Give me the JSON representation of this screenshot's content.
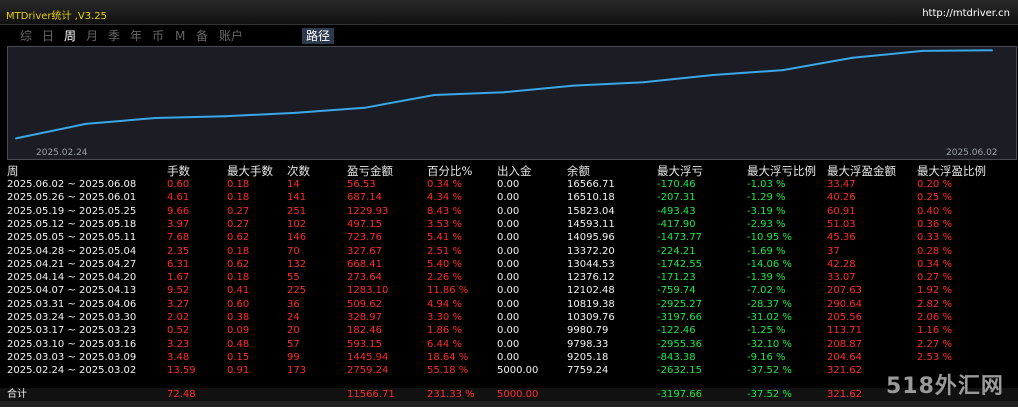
{
  "window": {
    "title": "MTDriver统计 ,V3.25",
    "link": "http://mtdriver.cn"
  },
  "tabs": [
    {
      "label": "综",
      "active": false
    },
    {
      "label": "日",
      "active": false
    },
    {
      "label": "周",
      "active": true
    },
    {
      "label": "月",
      "active": false
    },
    {
      "label": "季",
      "active": false
    },
    {
      "label": "年",
      "active": false
    },
    {
      "label": "币",
      "active": false
    },
    {
      "label": "M",
      "active": false
    },
    {
      "label": "备",
      "active": false
    },
    {
      "label": "账户",
      "active": false
    },
    {
      "label": "路径",
      "active": true
    }
  ],
  "chart_data": {
    "type": "line",
    "x_start_label": "2025.02.24",
    "x_end_label": "2025.06.02",
    "x": [
      "2025.02.24",
      "2025.03.03",
      "2025.03.10",
      "2025.03.17",
      "2025.03.24",
      "2025.03.31",
      "2025.04.07",
      "2025.04.14",
      "2025.04.21",
      "2025.04.28",
      "2025.05.05",
      "2025.05.12",
      "2025.05.19",
      "2025.05.26",
      "2025.06.02"
    ],
    "series": [
      {
        "values": [
          7759.24,
          9205.18,
          9798.33,
          9980.79,
          10309.76,
          10819.38,
          12102.48,
          12376.12,
          13044.53,
          13372.2,
          14095.96,
          14593.11,
          15823.04,
          16510.18,
          16566.71
        ]
      }
    ],
    "color": "#3aa8e8"
  },
  "headers": {
    "week": "周",
    "lots": "手数",
    "max_lots": "最大手数",
    "count": "次数",
    "pnl": "盈亏金额",
    "pct": "百分比%",
    "io": "出入金",
    "balance": "余额",
    "max_dd": "最大浮亏",
    "max_dd_pct": "最大浮亏比例",
    "max_fp": "最大浮盈金额",
    "max_fp_pct": "最大浮盈比例"
  },
  "rows": [
    {
      "week": "2025.06.02 ~ 2025.06.08",
      "lots": "0.60",
      "max_lots": "0.18",
      "count": "14",
      "pnl": "56.53",
      "pct": "0.34 %",
      "io": "0.00",
      "balance": "16566.71",
      "max_dd": "-170.46",
      "max_dd_pct": "-1.03 %",
      "max_fp": "33.47",
      "max_fp_pct": "0.20 %"
    },
    {
      "week": "2025.05.26 ~ 2025.06.01",
      "lots": "4.61",
      "max_lots": "0.18",
      "count": "141",
      "pnl": "687.14",
      "pct": "4.34 %",
      "io": "0.00",
      "balance": "16510.18",
      "max_dd": "-207.31",
      "max_dd_pct": "-1.29 %",
      "max_fp": "40.26",
      "max_fp_pct": "0.25 %"
    },
    {
      "week": "2025.05.19 ~ 2025.05.25",
      "lots": "9.66",
      "max_lots": "0.27",
      "count": "251",
      "pnl": "1229.93",
      "pct": "8.43 %",
      "io": "0.00",
      "balance": "15823.04",
      "max_dd": "-493.43",
      "max_dd_pct": "-3.19 %",
      "max_fp": "60.91",
      "max_fp_pct": "0.40 %"
    },
    {
      "week": "2025.05.12 ~ 2025.05.18",
      "lots": "3.97",
      "max_lots": "0.27",
      "count": "102",
      "pnl": "497.15",
      "pct": "3.53 %",
      "io": "0.00",
      "balance": "14593.11",
      "max_dd": "-417.90",
      "max_dd_pct": "-2.93 %",
      "max_fp": "51.03",
      "max_fp_pct": "0.36 %"
    },
    {
      "week": "2025.05.05 ~ 2025.05.11",
      "lots": "7.68",
      "max_lots": "0.62",
      "count": "146",
      "pnl": "723.76",
      "pct": "5.41 %",
      "io": "0.00",
      "balance": "14095.96",
      "max_dd": "-1473.77",
      "max_dd_pct": "-10.95 %",
      "max_fp": "45.36",
      "max_fp_pct": "0.33 %"
    },
    {
      "week": "2025.04.28 ~ 2025.05.04",
      "lots": "2.35",
      "max_lots": "0.18",
      "count": "70",
      "pnl": "327.67",
      "pct": "2.51 %",
      "io": "0.00",
      "balance": "13372.20",
      "max_dd": "-224.21",
      "max_dd_pct": "-1.69 %",
      "max_fp": "37",
      "max_fp_pct": "0.28 %"
    },
    {
      "week": "2025.04.21 ~ 2025.04.27",
      "lots": "6.31",
      "max_lots": "0.62",
      "count": "132",
      "pnl": "668.41",
      "pct": "5.40 %",
      "io": "0.00",
      "balance": "13044.53",
      "max_dd": "-1742.55",
      "max_dd_pct": "-14.06 %",
      "max_fp": "42.28",
      "max_fp_pct": "0.34 %"
    },
    {
      "week": "2025.04.14 ~ 2025.04.20",
      "lots": "1.67",
      "max_lots": "0.18",
      "count": "55",
      "pnl": "273.64",
      "pct": "2.26 %",
      "io": "0.00",
      "balance": "12376.12",
      "max_dd": "-171.23",
      "max_dd_pct": "-1.39 %",
      "max_fp": "33.07",
      "max_fp_pct": "0.27 %"
    },
    {
      "week": "2025.04.07 ~ 2025.04.13",
      "lots": "9.52",
      "max_lots": "0.41",
      "count": "225",
      "pnl": "1283.10",
      "pct": "11.86 %",
      "io": "0.00",
      "balance": "12102.48",
      "max_dd": "-759.74",
      "max_dd_pct": "-7.02 %",
      "max_fp": "207.63",
      "max_fp_pct": "1.92 %"
    },
    {
      "week": "2025.03.31 ~ 2025.04.06",
      "lots": "3.27",
      "max_lots": "0.60",
      "count": "36",
      "pnl": "509.62",
      "pct": "4.94 %",
      "io": "0.00",
      "balance": "10819.38",
      "max_dd": "-2925.27",
      "max_dd_pct": "-28.37 %",
      "max_fp": "290.64",
      "max_fp_pct": "2.82 %"
    },
    {
      "week": "2025.03.24 ~ 2025.03.30",
      "lots": "2.02",
      "max_lots": "0.38",
      "count": "24",
      "pnl": "328.97",
      "pct": "3.30 %",
      "io": "0.00",
      "balance": "10309.76",
      "max_dd": "-3197.66",
      "max_dd_pct": "-31.02 %",
      "max_fp": "205.56",
      "max_fp_pct": "2.06 %"
    },
    {
      "week": "2025.03.17 ~ 2025.03.23",
      "lots": "0.52",
      "max_lots": "0.09",
      "count": "20",
      "pnl": "182.46",
      "pct": "1.86 %",
      "io": "0.00",
      "balance": "9980.79",
      "max_dd": "-122.46",
      "max_dd_pct": "-1.25 %",
      "max_fp": "113.71",
      "max_fp_pct": "1.16 %"
    },
    {
      "week": "2025.03.10 ~ 2025.03.16",
      "lots": "3.23",
      "max_lots": "0.48",
      "count": "57",
      "pnl": "593.15",
      "pct": "6.44 %",
      "io": "0.00",
      "balance": "9798.33",
      "max_dd": "-2955.36",
      "max_dd_pct": "-32.10 %",
      "max_fp": "208.87",
      "max_fp_pct": "2.27 %"
    },
    {
      "week": "2025.03.03 ~ 2025.03.09",
      "lots": "3.48",
      "max_lots": "0.15",
      "count": "99",
      "pnl": "1445.94",
      "pct": "18.64 %",
      "io": "0.00",
      "balance": "9205.18",
      "max_dd": "-843.38",
      "max_dd_pct": "-9.16 %",
      "max_fp": "204.64",
      "max_fp_pct": "2.53 %"
    },
    {
      "week": "2025.02.24 ~ 2025.03.02",
      "lots": "13.59",
      "max_lots": "0.91",
      "count": "173",
      "pnl": "2759.24",
      "pct": "55.18 %",
      "io": "5000.00",
      "balance": "7759.24",
      "max_dd": "-2632.15",
      "max_dd_pct": "-37.52 %",
      "max_fp": "321.62",
      "max_fp_pct": ""
    }
  ],
  "total": {
    "label": "合计",
    "lots": "72.48",
    "pnl": "11566.71",
    "pct": "231.33 %",
    "io": "5000.00",
    "max_dd": "-3197.66",
    "max_dd_pct": "-37.52 %",
    "max_fp": "321.62"
  },
  "watermark": "518外汇网"
}
